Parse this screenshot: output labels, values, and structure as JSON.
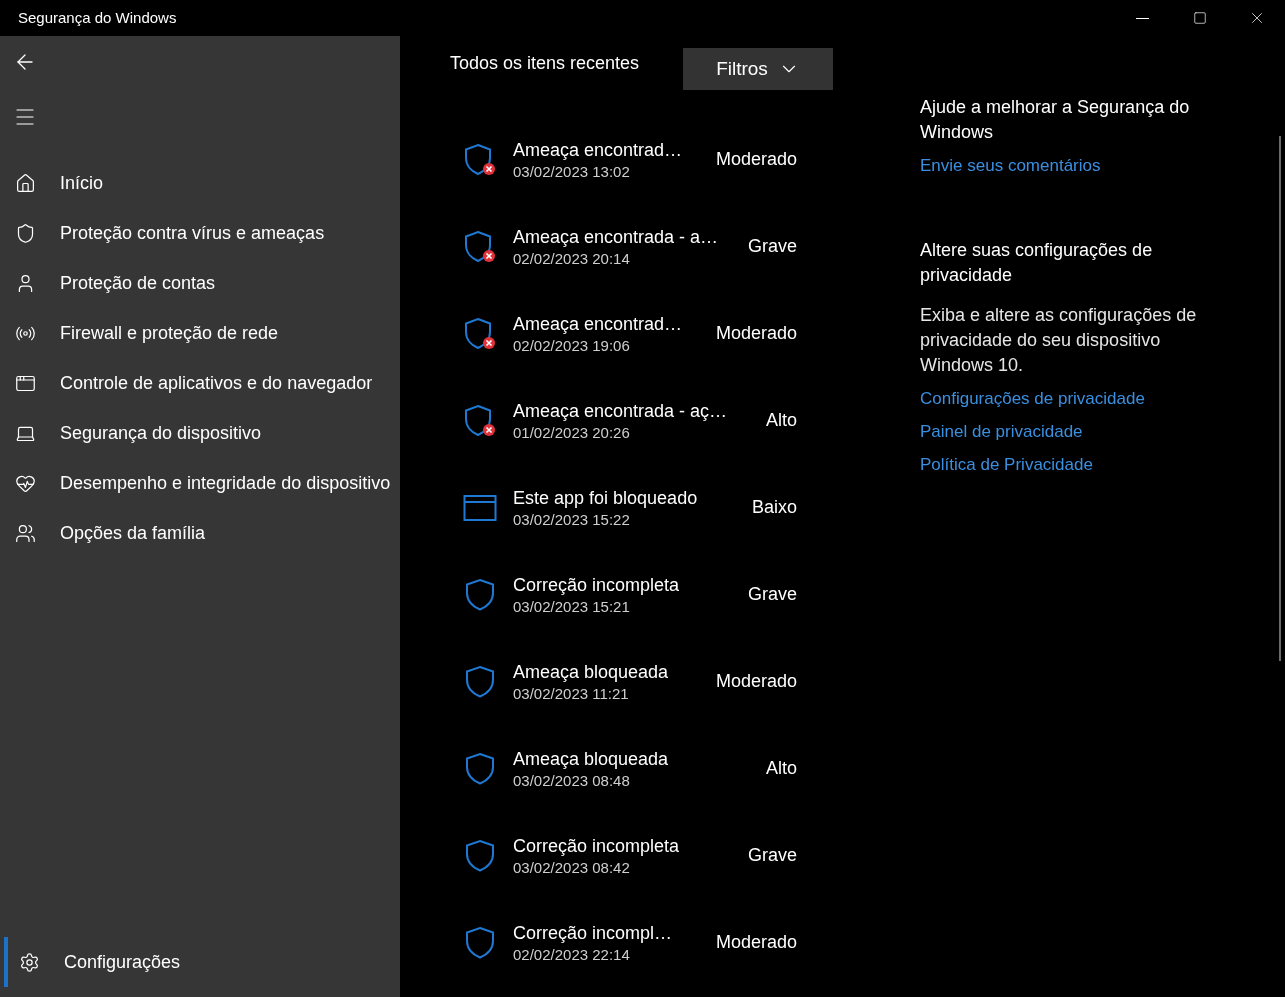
{
  "window": {
    "title": "Segurança do Windows"
  },
  "sidebar": {
    "items": [
      {
        "label": "Início",
        "kind": "home",
        "selected": false
      },
      {
        "label": "Proteção contra vírus e ameaças",
        "kind": "shield",
        "selected": false
      },
      {
        "label": "Proteção de contas",
        "kind": "user",
        "selected": false
      },
      {
        "label": "Firewall e proteção de rede",
        "kind": "antenna",
        "selected": false
      },
      {
        "label": "Controle de aplicativos e do navegador",
        "kind": "window",
        "selected": false
      },
      {
        "label": "Segurança do dispositivo",
        "kind": "laptop",
        "selected": false
      },
      {
        "label": "Desempenho e integridade do dispositivo",
        "kind": "heart",
        "selected": false
      },
      {
        "label": "Opções da família",
        "kind": "family",
        "selected": false
      }
    ],
    "footer": {
      "label": "Configurações",
      "kind": "gear",
      "selected": true
    }
  },
  "history": {
    "title": "Todos os itens recentes",
    "filter_button": "Filtros",
    "items": [
      {
        "kind": "threat",
        "title": "Ameaça encontrad…",
        "date": "03/02/2023 13:02",
        "severity": "Moderado"
      },
      {
        "kind": "threat",
        "title": "Ameaça encontrada - a…",
        "date": "02/02/2023 20:14",
        "severity": "Grave"
      },
      {
        "kind": "threat",
        "title": "Ameaça encontrad…",
        "date": "02/02/2023 19:06",
        "severity": "Moderado"
      },
      {
        "kind": "threat",
        "title": "Ameaça encontrada - aç…",
        "date": "01/02/2023 20:26",
        "severity": "Alto"
      },
      {
        "kind": "app",
        "title": "Este app foi bloqueado",
        "date": "03/02/2023 15:22",
        "severity": "Baixo"
      },
      {
        "kind": "shield",
        "title": "Correção incompleta",
        "date": "03/02/2023 15:21",
        "severity": "Grave"
      },
      {
        "kind": "shield",
        "title": "Ameaça bloqueada",
        "date": "03/02/2023 11:21",
        "severity": "Moderado"
      },
      {
        "kind": "shield",
        "title": "Ameaça bloqueada",
        "date": "03/02/2023 08:48",
        "severity": "Alto"
      },
      {
        "kind": "shield",
        "title": "Correção incompleta",
        "date": "03/02/2023 08:42",
        "severity": "Grave"
      },
      {
        "kind": "shield",
        "title": "Correção incompl…",
        "date": "02/02/2023 22:14",
        "severity": "Moderado"
      }
    ]
  },
  "aside": {
    "sections": [
      {
        "heading": "Ajude a melhorar a Segurança do Windows",
        "links": [
          "Envie seus comentários"
        ]
      },
      {
        "heading": "Altere suas configurações de privacidade",
        "text": "Exiba e altere as configurações de privacidade do seu dispositivo Windows 10.",
        "links": [
          "Configurações de privacidade",
          "Painel de privacidade",
          "Política de Privacidade"
        ]
      }
    ]
  }
}
